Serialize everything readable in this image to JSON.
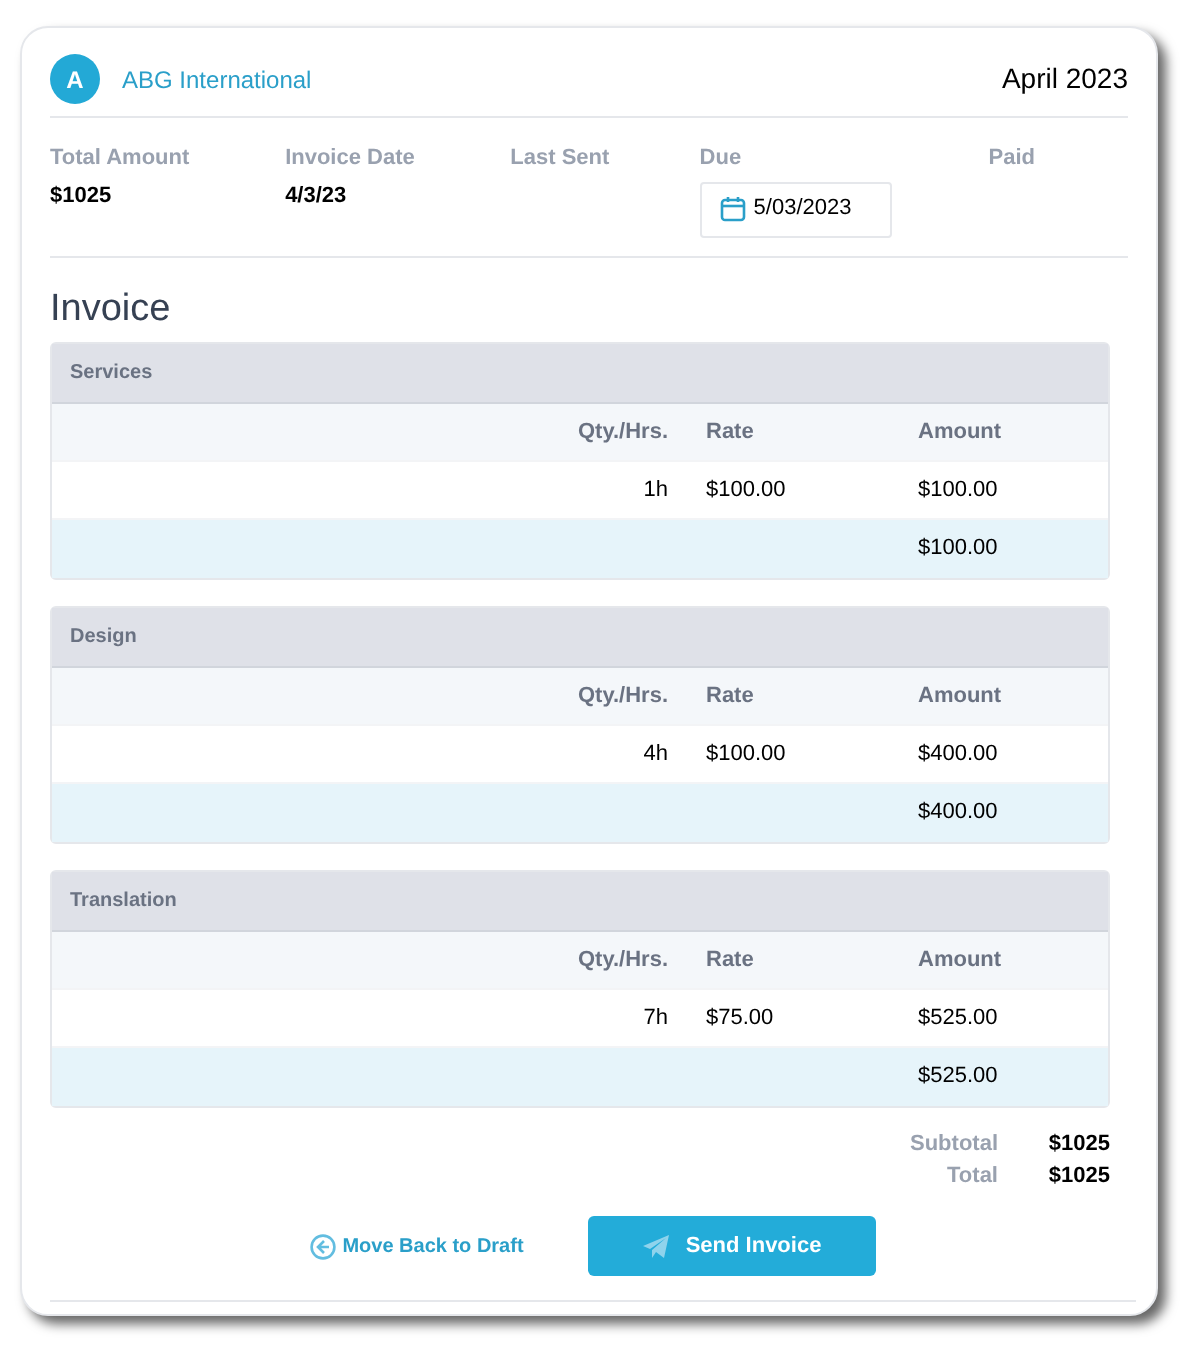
{
  "client": {
    "initial": "A",
    "name": "ABG International"
  },
  "period": "April 2023",
  "summary": [
    {
      "label": "Total Amount",
      "value": "$1025",
      "kind": "text"
    },
    {
      "label": "Invoice Date",
      "value": "4/3/23",
      "kind": "text"
    },
    {
      "label": "Last Sent",
      "kind": "text"
    },
    {
      "label": "Due",
      "value": "5/03/2023",
      "kind": "date"
    },
    {
      "label": "Paid",
      "kind": "text"
    }
  ],
  "title": "Invoice",
  "sections": [
    {
      "name": "Services",
      "columns": [
        "Qty./Hrs.",
        "Rate",
        "Amount"
      ],
      "rows": [
        [
          "1h",
          "$100.00",
          "$100.00"
        ]
      ],
      "total": "$100.00"
    },
    {
      "name": "Design",
      "columns": [
        "Qty./Hrs.",
        "Rate",
        "Amount"
      ],
      "rows": [
        [
          "4h",
          "$100.00",
          "$400.00"
        ]
      ],
      "total": "$400.00"
    },
    {
      "name": "Translation",
      "columns": [
        "Qty./Hrs.",
        "Rate",
        "Amount"
      ],
      "rows": [
        [
          "7h",
          "$75.00",
          "$525.00"
        ]
      ],
      "total": "$525.00"
    }
  ],
  "totals": [
    {
      "label": "Subtotal",
      "value": "$1025"
    },
    {
      "label": "Total",
      "value": "$1025"
    }
  ],
  "actions": {
    "back": "Move Back to Draft",
    "send": "Send Invoice"
  }
}
